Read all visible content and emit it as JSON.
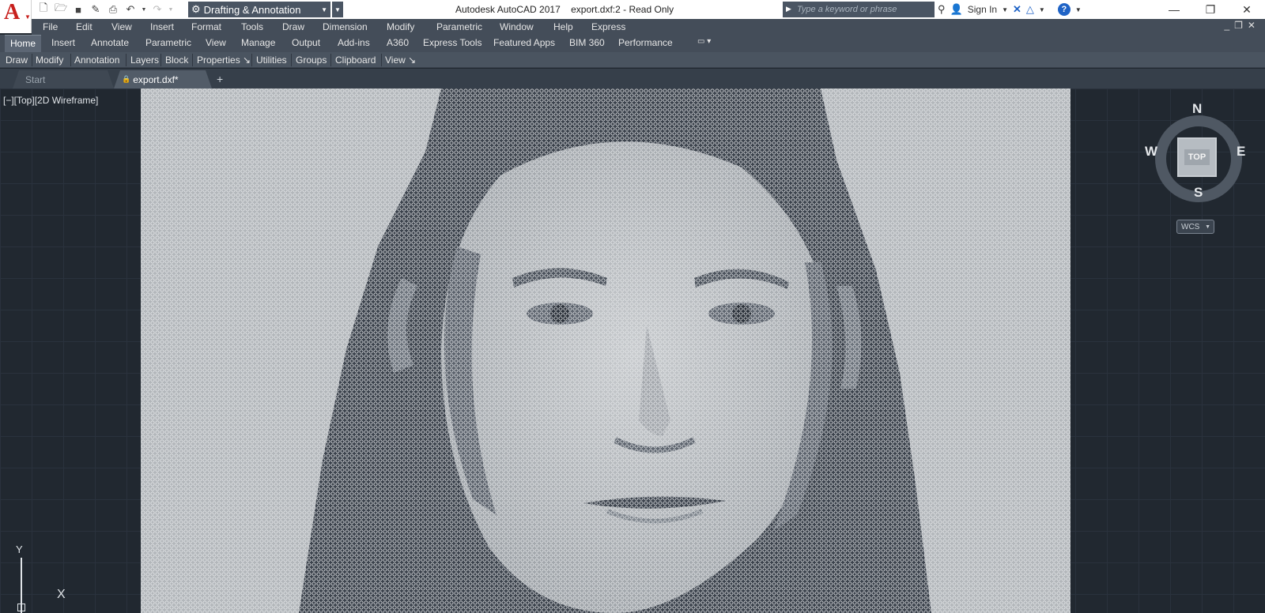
{
  "titlebar": {
    "workspace": "Drafting & Annotation",
    "title": "Autodesk AutoCAD 2017    export.dxf:2 - Read Only",
    "search_placeholder": "Type a keyword or phrase",
    "sign_in": "Sign In"
  },
  "menubar": {
    "items": [
      "File",
      "Edit",
      "View",
      "Insert",
      "Format",
      "Tools",
      "Draw",
      "Dimension",
      "Modify",
      "Parametric",
      "Window",
      "Help",
      "Express"
    ]
  },
  "ribbon": {
    "tabs": [
      "Home",
      "Insert",
      "Annotate",
      "Parametric",
      "View",
      "Manage",
      "Output",
      "Add-ins",
      "A360",
      "Express Tools",
      "Featured Apps",
      "BIM 360",
      "Performance"
    ],
    "active_tab": "Home",
    "panels": [
      "Draw",
      "Modify",
      "Annotation",
      "Layers",
      "Block",
      "Properties ↘",
      "Utilities",
      "Groups",
      "Clipboard",
      "View ↘"
    ]
  },
  "doc_tabs": {
    "start": "Start",
    "file": "export.dxf*"
  },
  "viewport": {
    "label": "[−][Top][2D Wireframe]"
  },
  "viewcube": {
    "n": "N",
    "s": "S",
    "e": "E",
    "w": "W",
    "face": "TOP",
    "wcs": "WCS"
  },
  "ucs": {
    "x": "X",
    "y": "Y"
  },
  "colors": {
    "titlebar_bg": "#ffffff",
    "menu_bg": "#444d59",
    "canvas_bg": "#212830",
    "portrait_light": "#adb1b6",
    "portrait_dark": "#2c333d",
    "accent_red": "#c8201d"
  }
}
